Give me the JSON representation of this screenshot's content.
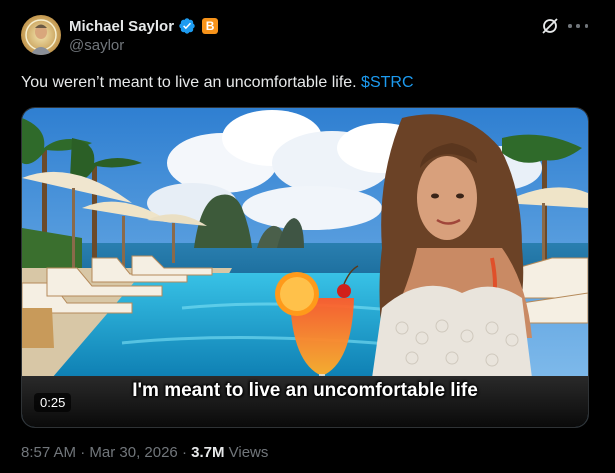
{
  "author": {
    "name": "Michael Saylor",
    "handle": "@saylor",
    "btc_badge": "B"
  },
  "post": {
    "text_before": "You weren’t meant to live an uncomfortable life. ",
    "cashtag": "$STRC"
  },
  "media": {
    "caption": "I'm meant to live an uncomfortable life",
    "duration": "0:25"
  },
  "meta": {
    "time": "8:57 AM",
    "sep1": " · ",
    "date": "Mar 30, 2026",
    "sep2": " · ",
    "views_count": "3.7M",
    "views_label": " Views"
  },
  "colors": {
    "background": "#000000",
    "text": "#e7e9ea",
    "secondary": "#71767b",
    "link": "#1d9bf0",
    "bitcoin": "#f7931a"
  },
  "icons": [
    "verified-badge-icon",
    "bitcoin-badge-icon",
    "grok-icon",
    "more-icon"
  ]
}
